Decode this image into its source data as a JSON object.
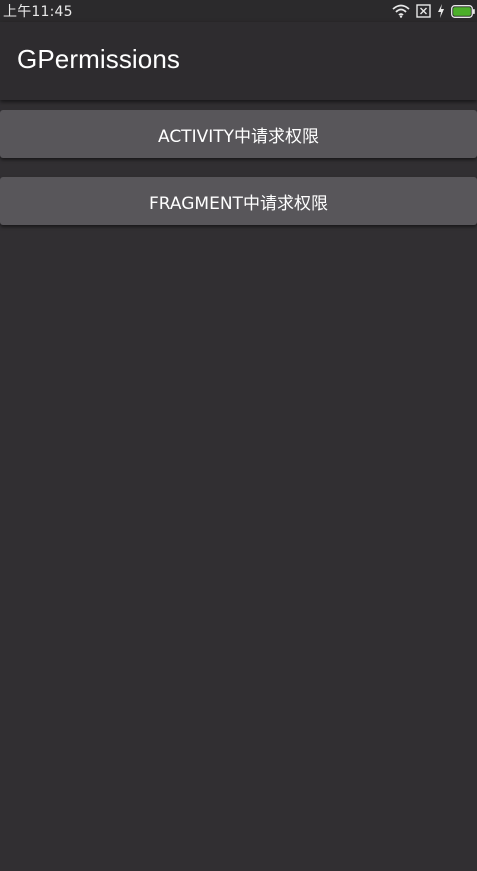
{
  "status_bar": {
    "time": "上午11:45",
    "icons": [
      "wifi-icon",
      "sim-card-icon",
      "charging-icon",
      "battery-icon"
    ],
    "battery_color": "#4caf2a"
  },
  "app_bar": {
    "title": "GPermissions"
  },
  "main": {
    "buttons": [
      {
        "label": "ACTIVITY中请求权限"
      },
      {
        "label": "FRAGMENT中请求权限"
      }
    ]
  },
  "colors": {
    "background": "#312f32",
    "button": "#58565a",
    "app_bar": "#2e2c2f"
  }
}
